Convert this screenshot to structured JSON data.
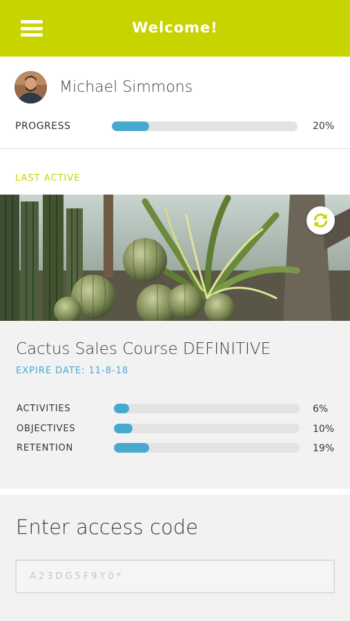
{
  "header": {
    "title": "Welcome!",
    "menu_icon": "hamburger-menu-icon",
    "background": "#c8d400"
  },
  "profile": {
    "name": "Michael Simmons",
    "progress_label": "PROGRESS",
    "progress_value": 20,
    "progress_text": "20%"
  },
  "last_active": {
    "label": "LAST ACTIVE",
    "refresh_icon": "refresh-icon",
    "course_title": "Cactus Sales Course DEFINITIVE",
    "expire": "EXPIRE DATE: 11-8-18",
    "metrics": [
      {
        "label": "ACTIVITIES",
        "value": 6,
        "text": "6%"
      },
      {
        "label": "OBJECTIVES",
        "value": 10,
        "text": "10%"
      },
      {
        "label": "RETENTION",
        "value": 19,
        "text": "19%"
      }
    ]
  },
  "access": {
    "title": "Enter access code",
    "placeholder": "A23DG5F9Y0*",
    "value": ""
  },
  "colors": {
    "accent": "#c8d400",
    "progress": "#48a9cf",
    "track": "#e3e3e3"
  }
}
